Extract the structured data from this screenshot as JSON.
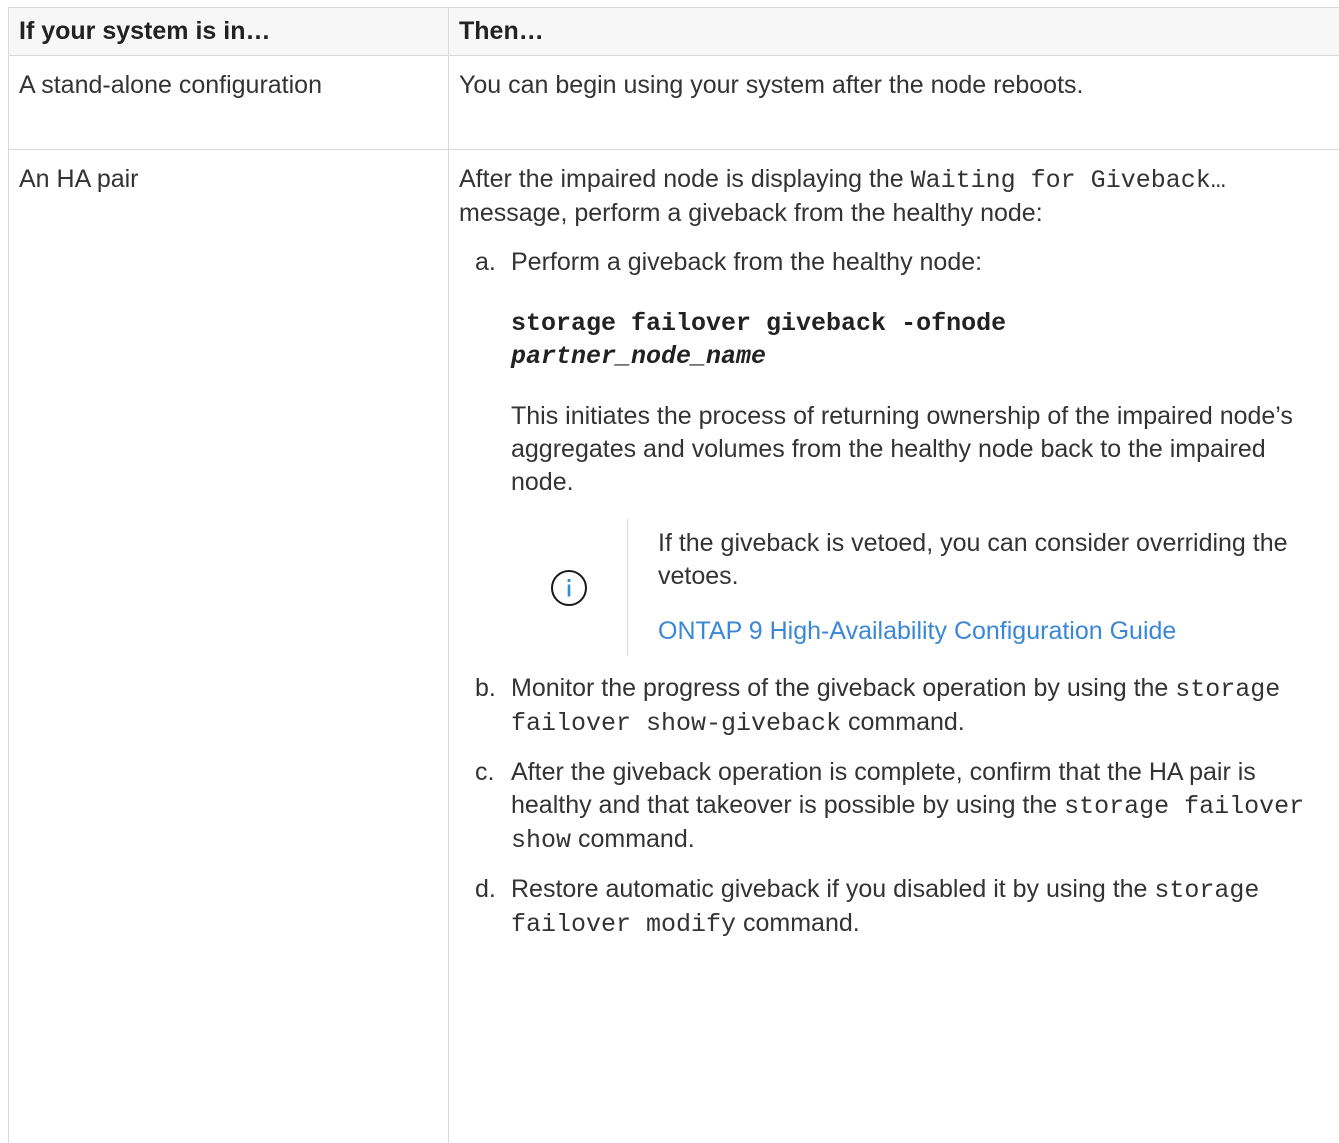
{
  "table": {
    "headers": [
      "If your system is in…",
      "Then…"
    ],
    "row1": {
      "condition": "A stand-alone configuration",
      "action": "You can begin using your system after the node reboots."
    },
    "row2": {
      "condition": "An HA pair",
      "intro_before": "After the impaired node is displaying the ",
      "intro_code": "Waiting for Giveback…",
      "intro_after": " message, perform a giveback from the healthy node:",
      "steps": {
        "a": {
          "marker": "a.",
          "text": "Perform a giveback from the healthy node:",
          "command": "storage failover giveback -ofnode",
          "command_arg": "partner_node_name",
          "description": "This initiates the process of returning ownership of the impaired node’s aggregates and volumes from the healthy node back to the impaired node.",
          "note": {
            "icon": "info-circle-icon",
            "text": "If the giveback is vetoed, you can consider overriding the vetoes.",
            "link": "ONTAP 9 High-Availability Configuration Guide"
          }
        },
        "b": {
          "marker": "b.",
          "before": "Monitor the progress of the giveback operation by using the ",
          "code": "storage failover show-giveback",
          "after": " command."
        },
        "c": {
          "marker": "c.",
          "before": "After the giveback operation is complete, confirm that the HA pair is healthy and that takeover is possible by using the ",
          "code": "storage failover show",
          "after": " command."
        },
        "d": {
          "marker": "d.",
          "before": "Restore automatic giveback if you disabled it by using the ",
          "code": "storage failover modify",
          "after": " command."
        }
      }
    }
  },
  "colors": {
    "link": "#3a87d6",
    "border": "#d9d9d9",
    "header_bg": "#f7f7f8",
    "text": "#333333"
  }
}
